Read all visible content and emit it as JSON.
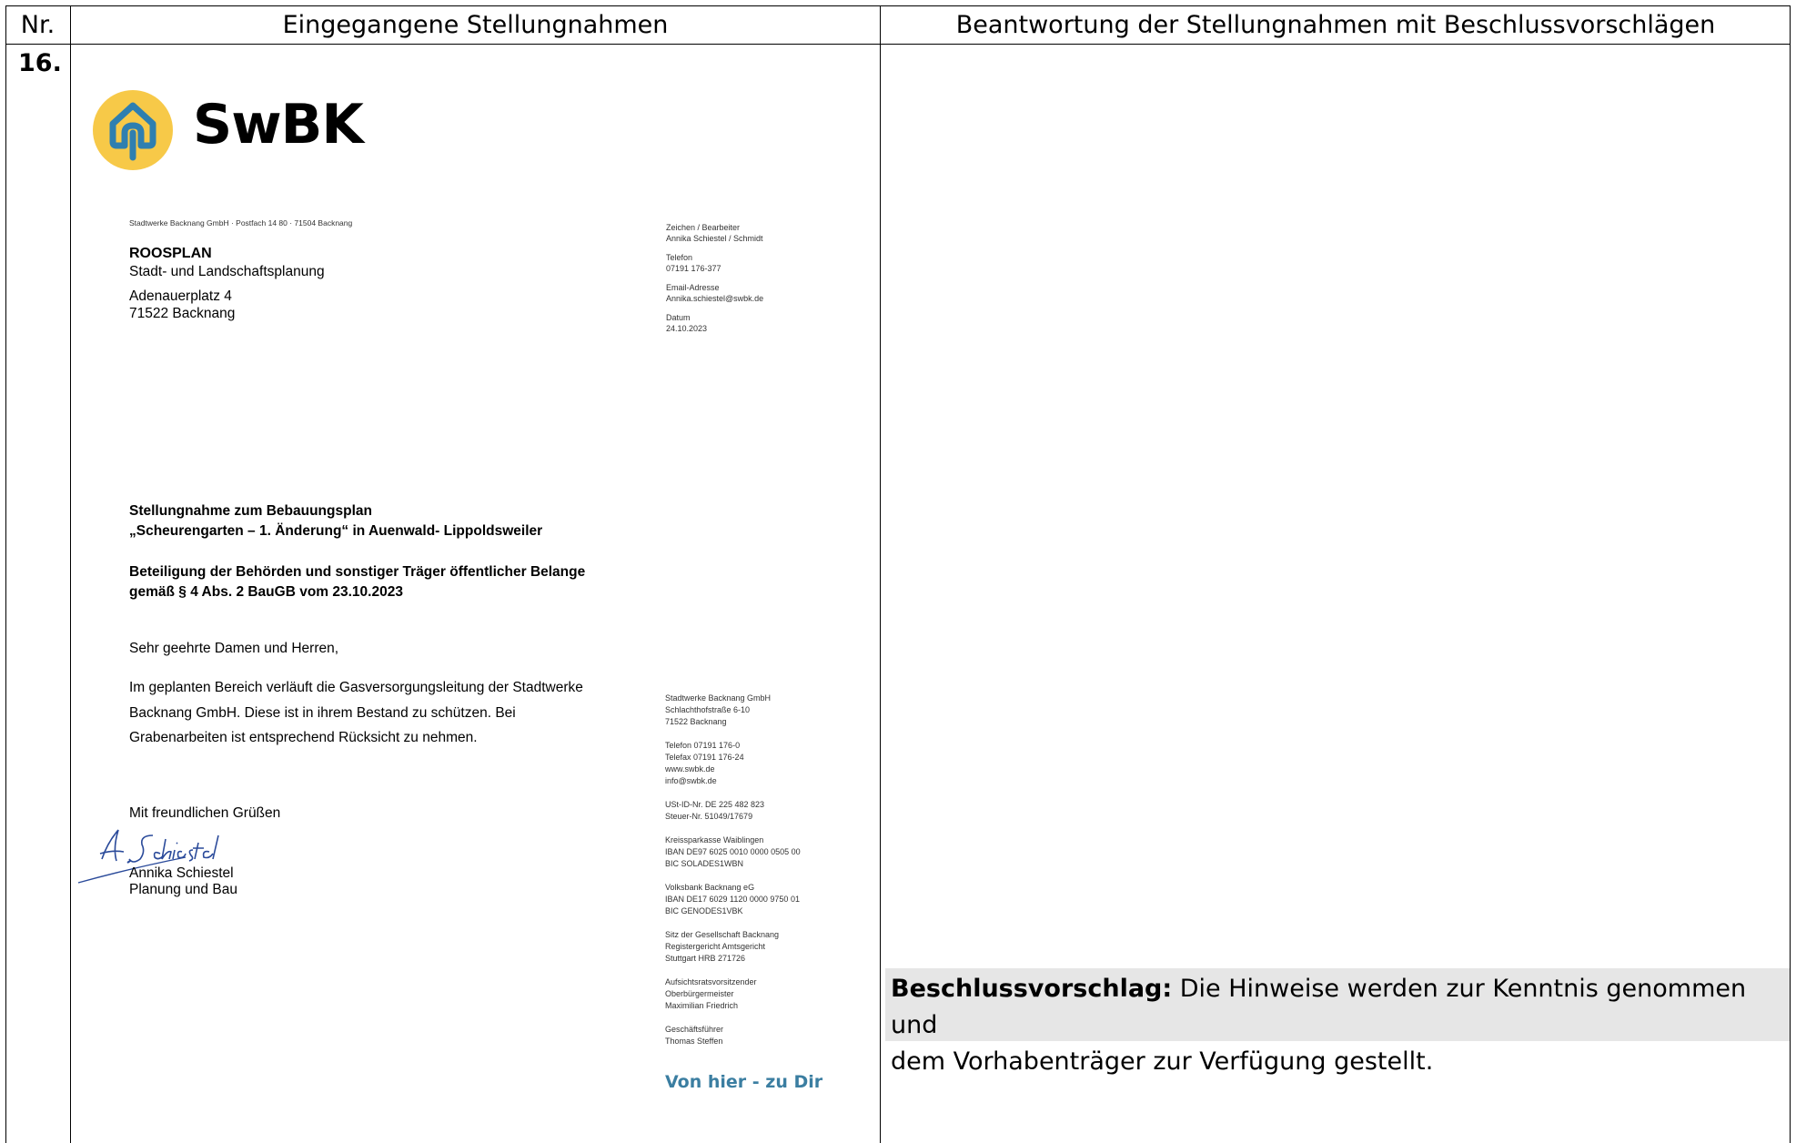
{
  "table": {
    "headers": {
      "nr": "Nr.",
      "received": "Eingegangene Stellungnahmen",
      "response": "Beantwortung der Stellungnahmen mit Beschlussvorschlägen"
    },
    "row_number": "16."
  },
  "letter": {
    "logo_text": "SwBK",
    "sender_line": "Stadtwerke Backnang GmbH · Postfach 14 80 · 71504 Backnang",
    "recipient": {
      "name": "ROOSPLAN",
      "subtitle": "Stadt- und Landschaftsplanung",
      "street": "Adenauerplatz 4",
      "city": "71522 Backnang"
    },
    "info": {
      "zeichen_label": "Zeichen / Bearbeiter",
      "zeichen_value": "Annika Schiestel / Schmidt",
      "telefon_label": "Telefon",
      "telefon_value": "07191 176-377",
      "email_label": "Email-Adresse",
      "email_value": "Annika.schiestel@swbk.de",
      "datum_label": "Datum",
      "datum_value": "24.10.2023"
    },
    "subject_line1": "Stellungnahme zum Bebauungsplan",
    "subject_line2": "„Scheurengarten – 1. Änderung“ in Auenwald- Lippoldsweiler",
    "subject_line3": "Beteiligung der Behörden und sonstiger Träger öffentlicher Belange",
    "subject_line4": "gemäß § 4 Abs. 2 BauGB vom 23.10.2023",
    "salutation": "Sehr geehrte Damen und Herren,",
    "body_line1": "Im geplanten Bereich verläuft die Gasversorgungsleitung der Stadtwerke",
    "body_line2": "Backnang GmbH. Diese ist in ihrem Bestand zu schützen. Bei",
    "body_line3": "Grabenarbeiten ist entsprechend Rücksicht zu nehmen.",
    "closing": "Mit freundlichen Grüßen",
    "signature_text": "A. Schiestel",
    "signer_name": "Annika Schiestel",
    "signer_dept": "Planung und Bau",
    "footer": {
      "company": "Stadtwerke Backnang GmbH",
      "street": "Schlachthofstraße 6-10",
      "city": "71522 Backnang",
      "telefon": "Telefon  07191 176-0",
      "telefax": "Telefax  07191 176-24",
      "web": "www.swbk.de",
      "mail": "info@swbk.de",
      "ust": "USt-ID-Nr. DE 225 482 823",
      "steuer": "Steuer-Nr. 51049/17679",
      "bank1_name": "Kreissparkasse Waiblingen",
      "bank1_iban": "IBAN DE97 6025 0010 0000 0505 00",
      "bank1_bic": "BIC SOLADES1WBN",
      "bank2_name": "Volksbank Backnang eG",
      "bank2_iban": "IBAN DE17 6029 1120 0000 9750 01",
      "bank2_bic": "BIC GENODES1VBK",
      "sitz1": "Sitz der Gesellschaft Backnang",
      "sitz2": "Registergericht Amtsgericht",
      "sitz3": "Stuttgart HRB 271726",
      "aufsicht1": "Aufsichtsratsvorsitzender",
      "aufsicht2": "Oberbürgermeister",
      "aufsicht3": "Maximilian Friedrich",
      "gf1": "Geschäftsführer",
      "gf2": "Thomas Steffen"
    },
    "slogan": "Von hier - zu Dir"
  },
  "response": {
    "label": "Beschlussvorschlag:",
    "text_line1": " Die Hinweise werden zur Kenntnis genommen und",
    "text_line2": "dem Vorhabenträger zur Verfügung gestellt."
  },
  "colors": {
    "logo_circle": "#f7c948",
    "logo_mark": "#2f7fb0",
    "slogan": "#3b7ea1",
    "response_bg": "#e6e6e6"
  }
}
